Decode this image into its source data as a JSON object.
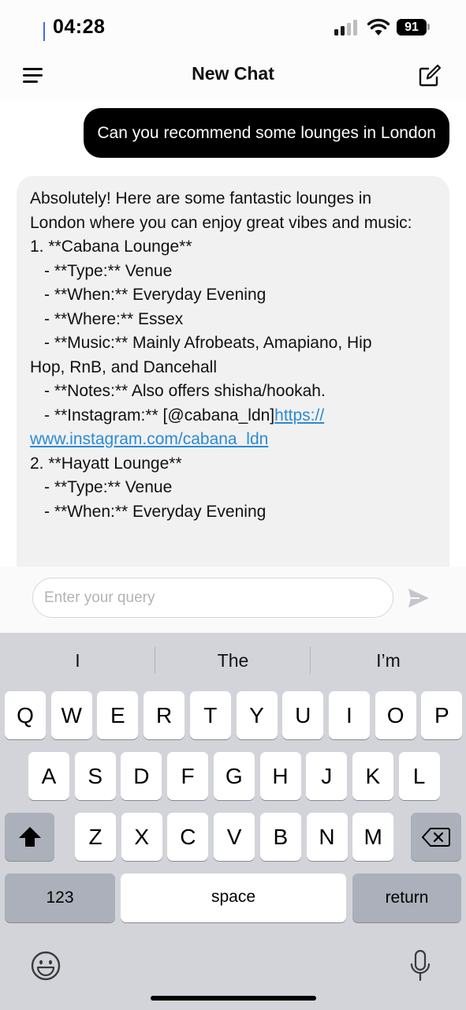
{
  "status_bar": {
    "time": "04:28",
    "battery": "91"
  },
  "header": {
    "title": "New Chat"
  },
  "chat": {
    "user_message": "Can you recommend some lounges in London",
    "bot_lines": {
      "l1": "Absolutely! Here are some fantastic lounges in",
      "l2": "London where you can enjoy great vibes and music:",
      "l3": "1. **Cabana Lounge**",
      "l4": "- **Type:** Venue",
      "l5": "- **When:** Everyday Evening",
      "l6": "- **Where:** Essex",
      "l7": "- **Music:** Mainly Afrobeats, Amapiano, Hip",
      "l8": "Hop, RnB, and Dancehall",
      "l9": "- **Notes:** Also offers shisha/hookah.",
      "l10": "- **Instagram:** [@cabana_ldn]",
      "l10_link": "https://",
      "l11_link": "www.instagram.com/cabana_ldn",
      "l12": "2. **Hayatt Lounge**",
      "l13": "- **Type:** Venue",
      "l14": "- **When:** Everyday Evening"
    }
  },
  "input": {
    "placeholder": "Enter your query"
  },
  "keyboard": {
    "suggestions": [
      "I",
      "The",
      "I’m"
    ],
    "row1": [
      "Q",
      "W",
      "E",
      "R",
      "T",
      "Y",
      "U",
      "I",
      "O",
      "P"
    ],
    "row2": [
      "A",
      "S",
      "D",
      "F",
      "G",
      "H",
      "J",
      "K",
      "L"
    ],
    "row3": [
      "Z",
      "X",
      "C",
      "V",
      "B",
      "N",
      "M"
    ],
    "numbers_label": "123",
    "space_label": "space",
    "return_label": "return"
  },
  "icons": {
    "menu": "menu-icon",
    "compose": "compose-icon",
    "send": "send-icon",
    "shift": "shift-icon",
    "backspace": "backspace-icon",
    "emoji": "emoji-icon",
    "microphone": "microphone-icon"
  },
  "colors": {
    "link": "#2a8bd6",
    "keyboard_bg": "#d2d4da",
    "user_bubble": "#000000",
    "bot_bubble": "#f1f1f1"
  }
}
